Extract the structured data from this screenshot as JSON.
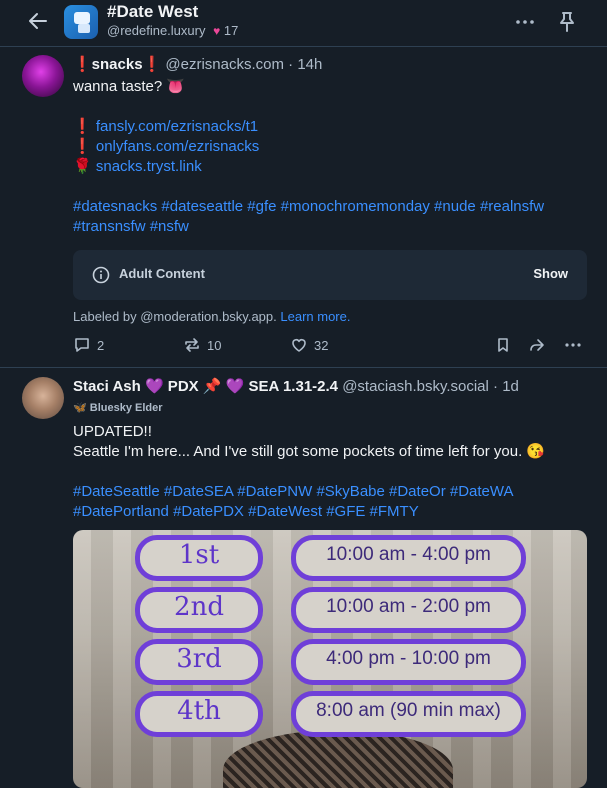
{
  "header": {
    "title": "#Date West",
    "subtitle": "@redefine.luxury",
    "likes": "17"
  },
  "post1": {
    "display_name": "❗snacks❗",
    "handle": "@ezrisnacks.com",
    "time": "14h",
    "line1": "wanna taste? 👅",
    "link1_prefix": "❗",
    "link1": "fansly.com/ezrisnacks/t1",
    "link2_prefix": "❗",
    "link2": "onlyfans.com/ezrisnacks",
    "link3_prefix": "🌹",
    "link3": "snacks.tryst.link",
    "tags_line1": "#datesnacks #dateseattle #gfe #monochromemonday #nude #realnsfw",
    "tags_line2": "#transnsfw #nsfw",
    "label_title": "Adult Content",
    "label_action": "Show",
    "labeled_by": "Labeled by @moderation.bsky.app.",
    "learn_more": "Learn more.",
    "replies": "2",
    "reposts": "10",
    "likes": "32"
  },
  "post2": {
    "display_name": "Staci Ash 💜 PDX 📌 💜 SEA 1.31-2.4",
    "handle": "@staciash.bsky.social",
    "time": "1d",
    "badge": "Bluesky Elder",
    "line1": "UPDATED!!",
    "line2": "Seattle I'm here... And I've still got some pockets of time left for you. 😘",
    "tags_line1": "#DateSeattle #DateSEA #DatePNW #SkyBabe #DateOr #DateWA",
    "tags_line2": "#DatePortland #DatePDX #DateWest #GFE #FMTY",
    "schedule": [
      {
        "day": "1st",
        "time": "10:00 am - 4:00 pm"
      },
      {
        "day": "2nd",
        "time": "10:00 am - 2:00 pm"
      },
      {
        "day": "3rd",
        "time": "4:00 pm - 10:00 pm"
      },
      {
        "day": "4th",
        "time": "8:00 am (90 min max)"
      }
    ]
  },
  "colors": {
    "background": "#161e27",
    "link": "#3a8fff",
    "accent_purple": "#6f3fd8",
    "muted": "#aebbc9"
  }
}
